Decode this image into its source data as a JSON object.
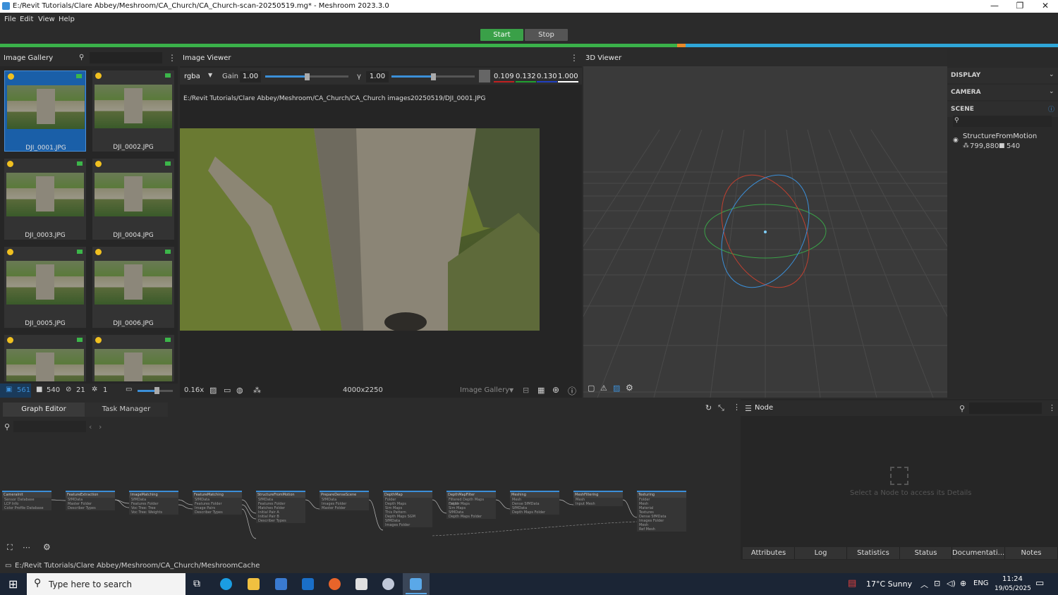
{
  "window": {
    "title": "E:/Revit Tutorials/Clare Abbey/Meshroom/CA_Church/CA_Church-scan-20250519.mg* - Meshroom 2023.3.0",
    "minimize": "—",
    "maximize": "❐",
    "close": "✕"
  },
  "menu": [
    "File",
    "Edit",
    "View",
    "Help"
  ],
  "run": {
    "start": "Start",
    "stop": "Stop"
  },
  "gallery": {
    "title": "Image Gallery",
    "images": [
      "DJI_0001.JPG",
      "DJI_0002.JPG",
      "DJI_0003.JPG",
      "DJI_0004.JPG",
      "DJI_0005.JPG",
      "DJI_0006.JPG",
      "",
      ""
    ],
    "footer": {
      "images_count": "561",
      "cameras_count": "540",
      "rejected_count": "21",
      "intrinsics_count": "1"
    }
  },
  "image_viewer": {
    "title": "Image Viewer",
    "channel": "rgba",
    "gain_label": "Gain",
    "gain_value": "1.00",
    "gamma_label": "γ",
    "gamma_value": "1.00",
    "pixel": {
      "r": "0.109",
      "g": "0.132",
      "b": "0.130",
      "a": "1.000"
    },
    "path": "E:/Revit Tutorials/Clare Abbey/Meshroom/CA_Church/CA_Church images20250519/DJI_0001.JPG",
    "zoom": "0.16x",
    "resolution": "4000x2250",
    "source": "Image Gallery"
  },
  "viewer3d": {
    "title": "3D Viewer",
    "sections": {
      "display": "DISPLAY",
      "camera": "CAMERA",
      "scene": "SCENE"
    },
    "scene_item": {
      "name": "StructureFromMotion",
      "points": "799,880",
      "cameras": "540"
    }
  },
  "bottom": {
    "tabs": [
      "Graph Editor",
      "Task Manager"
    ],
    "node_panel_title": "Node",
    "node_placeholder": "Select a Node to access its Details",
    "node_tabs": [
      "Attributes",
      "Log",
      "Statistics",
      "Status",
      "Documentati...",
      "Notes"
    ],
    "nodes": [
      {
        "name": "CameraInit",
        "rows": [
          "Sensor Database",
          "LCP Info",
          "Color Profile Database"
        ]
      },
      {
        "name": "FeatureExtraction",
        "rows": [
          "SfMData",
          "Master Folder",
          "Describer Types"
        ]
      },
      {
        "name": "ImageMatching",
        "rows": [
          "SfMData",
          "Features Folder",
          "Voc Tree: Tree",
          "Voc Tree: Weights"
        ]
      },
      {
        "name": "FeatureMatching",
        "rows": [
          "SfMData",
          "Features Folder",
          "Image Pairs",
          "Describer Types"
        ]
      },
      {
        "name": "StructureFromMotion",
        "rows": [
          "SfMData",
          "Features Folder",
          "Matches Folder",
          "Initial Pair A",
          "Initial Pair B",
          "Describer Types"
        ]
      },
      {
        "name": "PrepareDenseScene",
        "rows": [
          "SfMData",
          "Images Folder",
          "Master Folder"
        ]
      },
      {
        "name": "DepthMap",
        "rows": [
          "Folder",
          "Depth Maps",
          "Sim Maps",
          "This Pattern",
          "Depth Maps SGM",
          "SfMData",
          "Images Folder"
        ]
      },
      {
        "name": "DepthMapFilter",
        "rows": [
          "Filtered Depth Maps Folder",
          "Depth Maps",
          "Sim Maps",
          "SfMData",
          "Depth Maps Folder"
        ]
      },
      {
        "name": "Meshing",
        "rows": [
          "Mesh",
          "Dense SfMData",
          "SfMData",
          "Depth Maps Folder"
        ]
      },
      {
        "name": "MeshFiltering",
        "rows": [
          "Mesh",
          "Input Mesh"
        ]
      },
      {
        "name": "Texturing",
        "rows": [
          "Folder",
          "Mesh",
          "Material",
          "Textures",
          "Dense SfMData",
          "Images Folder",
          "Mesh",
          "Ref Mesh"
        ]
      }
    ]
  },
  "status": {
    "cache_path": "E:/Revit Tutorials/Clare Abbey/Meshroom/CA_Church/MeshroomCache"
  },
  "taskbar": {
    "search_placeholder": "Type here to search",
    "weather": "17°C  Sunny",
    "language": "ENG",
    "time": "11:24",
    "date": "19/05/2025"
  }
}
